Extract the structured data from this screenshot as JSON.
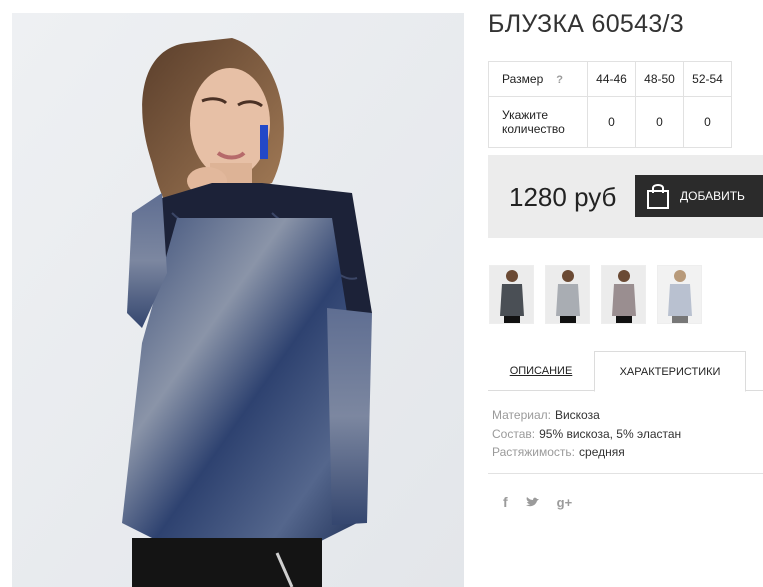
{
  "product": {
    "title": "БЛУЗКА 60543/3",
    "photo_icon": "product-photo"
  },
  "size_table": {
    "size_label": "Размер",
    "help_mark": "?",
    "sizes": [
      "44-46",
      "48-50",
      "52-54"
    ],
    "quantity_label": "Укажите количество",
    "quantities": [
      "0",
      "0",
      "0"
    ]
  },
  "price": {
    "amount": "1280 руб",
    "add_button_label": "ДОБАВИТЬ",
    "cart_icon": "shopping-bag-icon"
  },
  "thumbnails": [
    "thumb-grey-black",
    "thumb-light-grey",
    "thumb-grey-pink",
    "thumb-light-blue"
  ],
  "tabs": {
    "description": "ОПИСАНИЕ",
    "characteristics": "ХАРАКТЕРИСТИКИ",
    "active": "characteristics"
  },
  "specs": [
    {
      "key": "Материал:",
      "value": "Вискоза"
    },
    {
      "key": "Состав:",
      "value": "95% вискоза, 5% эластан"
    },
    {
      "key": "Растяжимость:",
      "value": "средняя"
    }
  ],
  "social": {
    "facebook": "f",
    "twitter": "twitter-bird-icon",
    "google_plus": "g+"
  },
  "colors": {
    "button_bg": "#2b2b2b",
    "price_bg": "#ececec",
    "blouse": "#2c3f66"
  }
}
